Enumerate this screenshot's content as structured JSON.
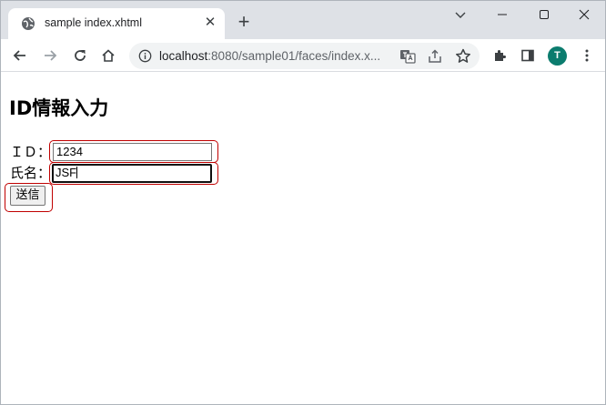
{
  "browser": {
    "tab_title": "sample index.xhtml",
    "close_tab_glyph": "✕",
    "new_tab_glyph": "+",
    "url_host": "localhost",
    "url_path": ":8080/sample01/faces/index.x...",
    "profile_initial": "T"
  },
  "page": {
    "heading": "ID情報入力",
    "id_label": "ＩＤ：",
    "id_value": "1234",
    "name_label": "氏名：",
    "name_value": "JSF",
    "submit_label": "送信"
  },
  "colors": {
    "highlight": "#c00000",
    "avatar": "#0b7c6e"
  }
}
